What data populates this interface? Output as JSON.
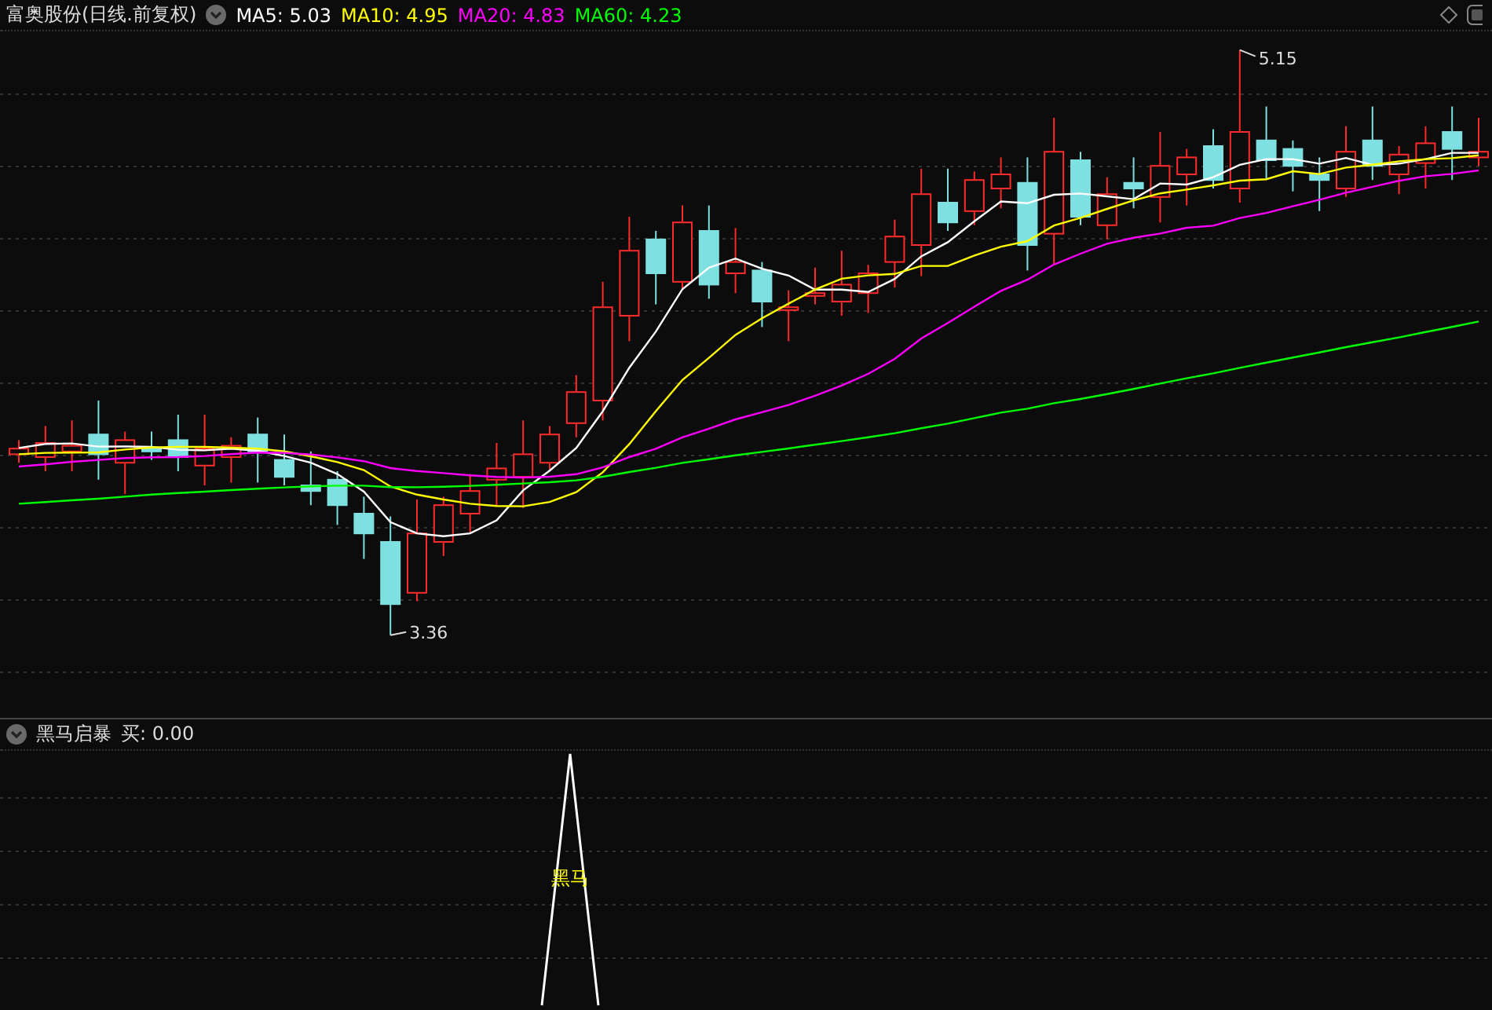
{
  "main_panel": {
    "title": "富奥股份(日线.前复权)",
    "moving_averages": [
      {
        "label": "MA5:",
        "value": "5.03",
        "color": "#ffffff"
      },
      {
        "label": "MA10:",
        "value": "4.95",
        "color": "#ffff00"
      },
      {
        "label": "MA20:",
        "value": "4.83",
        "color": "#ff00ff"
      },
      {
        "label": "MA60:",
        "value": "4.23",
        "color": "#00ff00"
      }
    ],
    "high_marker": "5.15",
    "low_marker": "3.36"
  },
  "indicator_panel": {
    "title": "黑马启暴",
    "reading": "买: 0.00",
    "signal_label": "黑马"
  }
}
